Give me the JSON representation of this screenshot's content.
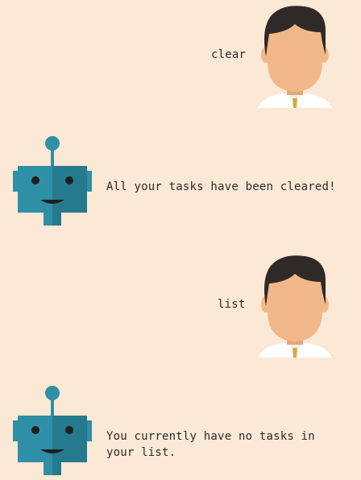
{
  "conversation": {
    "messages": [
      {
        "sender": "user",
        "avatar_icon": "user-avatar-icon",
        "text": "clear"
      },
      {
        "sender": "bot",
        "avatar_icon": "robot-avatar-icon",
        "text": "All your tasks have been cleared!"
      },
      {
        "sender": "user",
        "avatar_icon": "user-avatar-icon",
        "text": "list"
      },
      {
        "sender": "bot",
        "avatar_icon": "robot-avatar-icon",
        "text": "You currently have no tasks in\nyour list."
      }
    ]
  },
  "colors": {
    "background": "#fbe8d5",
    "text": "#2b2b2b",
    "robot_body": "#2f8fa6",
    "robot_shade": "#267a8e",
    "user_skin": "#f0b888",
    "user_hair": "#2f2a28",
    "user_shirt": "#ffffff",
    "user_tie": "#d8a83a"
  }
}
